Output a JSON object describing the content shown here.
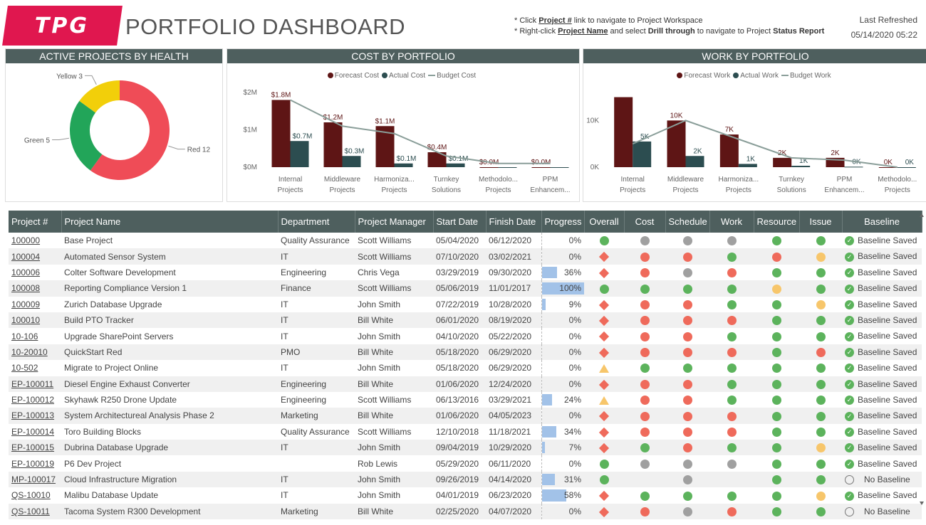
{
  "header": {
    "logo_text": "TPG",
    "title": "PORTFOLIO DASHBOARD",
    "note1_prefix": "* Click ",
    "note1_link": "Project #",
    "note1_suffix": " link to navigate to Project Workspace",
    "note2_prefix": "* Right-click ",
    "note2_link": "Project Name",
    "note2_mid": " and select ",
    "note2_bold1": "Drill through",
    "note2_mid2": " to navigate to Project ",
    "note2_bold2": "Status Report",
    "refresh_label": "Last Refreshed",
    "refresh_value": "05/14/2020 05:22"
  },
  "panels": {
    "health_title": "ACTIVE PROJECTS BY HEALTH",
    "cost_title": "COST BY PORTFOLIO",
    "work_title": "WORK BY PORTFOLIO"
  },
  "colors": {
    "forecast": "#5e1515",
    "actual": "#2c4d50",
    "budget": "#8a9e99",
    "red": "#ef4c57",
    "green": "#22a559",
    "yellow": "#f2cf0a",
    "header": "#4e5f5e",
    "brand": "#e0174f"
  },
  "chart_data": [
    {
      "type": "pie",
      "title": "ACTIVE PROJECTS BY HEALTH",
      "categories": [
        "Red",
        "Green",
        "Yellow"
      ],
      "values": [
        12,
        5,
        3
      ],
      "labels": [
        "Red 12",
        "Green 5",
        "Yellow 3"
      ]
    },
    {
      "type": "bar",
      "title": "COST BY PORTFOLIO",
      "categories": [
        "Internal Projects",
        "Middleware Projects",
        "Harmoniza... Projects",
        "Turnkey Solutions",
        "Methodolo... Projects",
        "PPM Enhancem..."
      ],
      "category_lines": [
        [
          "Internal",
          "Projects"
        ],
        [
          "Middleware",
          "Projects"
        ],
        [
          "Harmoniza...",
          "Projects"
        ],
        [
          "Turnkey",
          "Solutions"
        ],
        [
          "Methodolo...",
          "Projects"
        ],
        [
          "PPM",
          "Enhancem..."
        ]
      ],
      "series": [
        {
          "name": "Forecast Cost",
          "values": [
            1.8,
            1.2,
            1.1,
            0.4,
            0.0,
            0.0
          ],
          "labels": [
            "$1.8M",
            "$1.2M",
            "$1.1M",
            "$0.4M",
            "$0.0M",
            "$0.0M"
          ]
        },
        {
          "name": "Actual Cost",
          "values": [
            0.7,
            0.3,
            0.1,
            0.1,
            0.0,
            0.0
          ],
          "labels": [
            "$0.7M",
            "$0.3M",
            "$0.1M",
            "$0.1M",
            "",
            ""
          ]
        },
        {
          "name": "Budget Cost",
          "values": [
            1.8,
            1.1,
            0.9,
            0.3,
            0.1,
            0.1
          ]
        }
      ],
      "legend": [
        "Forecast Cost",
        "Actual Cost",
        "Budget Cost"
      ],
      "yticks": [
        "$0M",
        "$1M",
        "$2M"
      ],
      "ylim": [
        0,
        2
      ]
    },
    {
      "type": "bar",
      "title": "WORK BY PORTFOLIO",
      "categories": [
        "Internal Projects",
        "Middleware Projects",
        "Harmoniza... Projects",
        "Turnkey Solutions",
        "PPM Enhancem...",
        "Methodolo... Projects"
      ],
      "category_lines": [
        [
          "Internal",
          "Projects"
        ],
        [
          "Middleware",
          "Projects"
        ],
        [
          "Harmoniza...",
          "Projects"
        ],
        [
          "Turnkey",
          "Solutions"
        ],
        [
          "PPM",
          "Enhancem..."
        ],
        [
          "Methodolo...",
          "Projects"
        ]
      ],
      "series": [
        {
          "name": "Forecast Work",
          "values": [
            15,
            10,
            7,
            2,
            2,
            0
          ],
          "labels": [
            "",
            "10K",
            "7K",
            "2K",
            "2K",
            "0K"
          ]
        },
        {
          "name": "Actual Work",
          "values": [
            5.5,
            2.4,
            0.7,
            0.3,
            0.1,
            0.0
          ],
          "labels": [
            "5K",
            "2K",
            "1K",
            "1K",
            "0K",
            "0K"
          ]
        },
        {
          "name": "Budget Work",
          "values": [
            5,
            10,
            6,
            2,
            1.5,
            0
          ]
        }
      ],
      "legend": [
        "Forecast Work",
        "Actual Work",
        "Budget Work"
      ],
      "yticks": [
        "0K",
        "10K"
      ],
      "ylim": [
        0,
        16
      ]
    }
  ],
  "table": {
    "columns": [
      "Project #",
      "Project Name",
      "Department",
      "Project Manager",
      "Start Date",
      "Finish Date",
      "Progress",
      "Overall",
      "Cost",
      "Schedule",
      "Work",
      "Resource",
      "Issue",
      "Baseline"
    ],
    "rows": [
      [
        "100000",
        "Base Project",
        "Quality Assurance",
        "Scott Williams",
        "05/04/2020",
        "06/12/2020",
        "0%",
        "g",
        "gr",
        "gr",
        "gr",
        "g",
        "g",
        "Baseline Saved"
      ],
      [
        "100004",
        "Automated Sensor System",
        "IT",
        "Scott Williams",
        "07/10/2020",
        "03/02/2021",
        "0%",
        "dm",
        "r",
        "r",
        "g",
        "r",
        "y",
        "Baseline Saved"
      ],
      [
        "100006",
        "Colter Software Development",
        "Engineering",
        "Chris Vega",
        "03/29/2019",
        "09/30/2020",
        "36%",
        "dm",
        "r",
        "gr",
        "r",
        "g",
        "g",
        "Baseline Saved"
      ],
      [
        "100008",
        "Reporting Compliance Version 1",
        "Finance",
        "Scott Williams",
        "05/06/2019",
        "11/01/2017",
        "100%",
        "g",
        "g",
        "g",
        "g",
        "y",
        "g",
        "Baseline Saved"
      ],
      [
        "100009",
        "Zurich Database Upgrade",
        "IT",
        "John Smith",
        "07/22/2019",
        "10/28/2020",
        "9%",
        "dm",
        "r",
        "r",
        "g",
        "g",
        "y",
        "Baseline Saved"
      ],
      [
        "100010",
        "Build PTO Tracker",
        "IT",
        "Bill White",
        "06/01/2020",
        "08/19/2020",
        "0%",
        "dm",
        "r",
        "r",
        "r",
        "g",
        "g",
        "Baseline Saved"
      ],
      [
        "10-106",
        "Upgrade SharePoint Servers",
        "IT",
        "John Smith",
        "04/10/2020",
        "05/22/2020",
        "0%",
        "dm",
        "r",
        "r",
        "g",
        "g",
        "g",
        "Baseline Saved"
      ],
      [
        "10-20010",
        "QuickStart Red",
        "PMO",
        "Bill White",
        "05/18/2020",
        "06/29/2020",
        "0%",
        "dm",
        "r",
        "r",
        "r",
        "g",
        "r",
        "Baseline Saved"
      ],
      [
        "10-502",
        "Migrate to Project Online",
        "IT",
        "John Smith",
        "05/18/2020",
        "06/29/2020",
        "0%",
        "tri",
        "g",
        "g",
        "g",
        "g",
        "g",
        "Baseline Saved"
      ],
      [
        "EP-100011",
        "Diesel Engine Exhaust Converter",
        "Engineering",
        "Bill White",
        "01/06/2020",
        "12/24/2020",
        "0%",
        "dm",
        "r",
        "r",
        "g",
        "g",
        "g",
        "Baseline Saved"
      ],
      [
        "EP-100012",
        "Skyhawk R250 Drone Update",
        "Engineering",
        "Scott Williams",
        "06/13/2016",
        "03/29/2021",
        "24%",
        "tri",
        "r",
        "r",
        "g",
        "g",
        "g",
        "Baseline Saved"
      ],
      [
        "EP-100013",
        "System Architectureal Analysis Phase 2",
        "Marketing",
        "Bill White",
        "01/06/2020",
        "04/05/2023",
        "0%",
        "dm",
        "r",
        "r",
        "r",
        "g",
        "g",
        "Baseline Saved"
      ],
      [
        "EP-100014",
        "Toro Building Blocks",
        "Quality Assurance",
        "Scott Williams",
        "12/10/2018",
        "11/18/2021",
        "34%",
        "dm",
        "r",
        "r",
        "r",
        "g",
        "g",
        "Baseline Saved"
      ],
      [
        "EP-100015",
        "Dubrina Database Upgrade",
        "IT",
        "John Smith",
        "09/04/2019",
        "10/29/2020",
        "7%",
        "dm",
        "g",
        "r",
        "g",
        "g",
        "y",
        "Baseline Saved"
      ],
      [
        "EP-100019",
        "P6 Dev Project",
        "",
        "Rob Lewis",
        "05/29/2020",
        "06/11/2020",
        "0%",
        "g",
        "gr",
        "gr",
        "gr",
        "g",
        "g",
        "Baseline Saved"
      ],
      [
        "MP-100017",
        "Cloud Infrastructure Migration",
        "IT",
        "John Smith",
        "09/26/2019",
        "04/14/2020",
        "31%",
        "g",
        "",
        "gr",
        "",
        "g",
        "g",
        "No Baseline"
      ],
      [
        "QS-10010",
        "Malibu Database Update",
        "IT",
        "John Smith",
        "04/01/2019",
        "06/23/2020",
        "58%",
        "dm",
        "g",
        "g",
        "g",
        "g",
        "y",
        "Baseline Saved"
      ],
      [
        "QS-10011",
        "Tacoma System R300 Development",
        "Marketing",
        "Bill White",
        "02/25/2020",
        "04/07/2020",
        "0%",
        "dm",
        "r",
        "gr",
        "r",
        "g",
        "g",
        "No Baseline"
      ]
    ]
  }
}
